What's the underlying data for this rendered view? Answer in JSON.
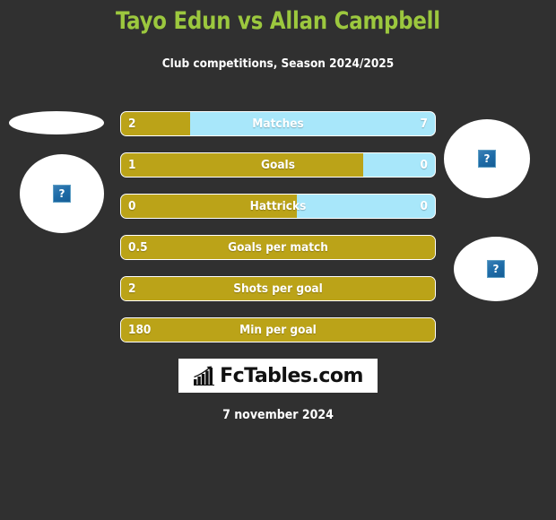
{
  "header": {
    "title": "Tayo Edun vs Allan Campbell",
    "subtitle": "Club competitions, Season 2024/2025",
    "title_color": "#9CC83E",
    "subtitle_color": "#FFFFFF"
  },
  "theme": {
    "background": "#303030",
    "home_color": "#BBA318",
    "away_color": "#A8E7FA",
    "text_color": "#FFFFFF"
  },
  "players": {
    "home": {
      "name": "Tayo Edun",
      "photo_alt": "broken-image",
      "flag_alt": "broken-image"
    },
    "away": {
      "name": "Allan Campbell",
      "photo_alt": "broken-image",
      "flag_alt": "broken-image"
    }
  },
  "placeholder": {
    "glyph": "?"
  },
  "chart_data": {
    "type": "bar",
    "title": "Tayo Edun vs Allan Campbell",
    "subtitle": "Club competitions, Season 2024/2025",
    "orientation": "horizontal-diverging",
    "categories": [
      "Matches",
      "Goals",
      "Hattricks",
      "Goals per match",
      "Shots per goal",
      "Min per goal"
    ],
    "series": [
      {
        "name": "Tayo Edun",
        "color": "#BBA318",
        "values": [
          2,
          1,
          0,
          0.5,
          2,
          180
        ]
      },
      {
        "name": "Allan Campbell",
        "color": "#A8E7FA",
        "values": [
          7,
          0,
          0,
          null,
          null,
          null
        ]
      }
    ],
    "rows": [
      {
        "label": "Matches",
        "left_value": "2",
        "right_value": "7",
        "left_pct": 22,
        "has_right": true
      },
      {
        "label": "Goals",
        "left_value": "1",
        "right_value": "0",
        "left_pct": 77,
        "has_right": true
      },
      {
        "label": "Hattricks",
        "left_value": "0",
        "right_value": "0",
        "left_pct": 56,
        "has_right": true
      },
      {
        "label": "Goals per match",
        "left_value": "0.5",
        "right_value": "",
        "left_pct": 100,
        "has_right": false
      },
      {
        "label": "Shots per goal",
        "left_value": "2",
        "right_value": "",
        "left_pct": 100,
        "has_right": false
      },
      {
        "label": "Min per goal",
        "left_value": "180",
        "right_value": "",
        "left_pct": 100,
        "has_right": false
      }
    ]
  },
  "logo": {
    "text": "FcTables.com",
    "icon": "bar-chart-growth-icon"
  },
  "footer": {
    "date": "7 november 2024"
  }
}
